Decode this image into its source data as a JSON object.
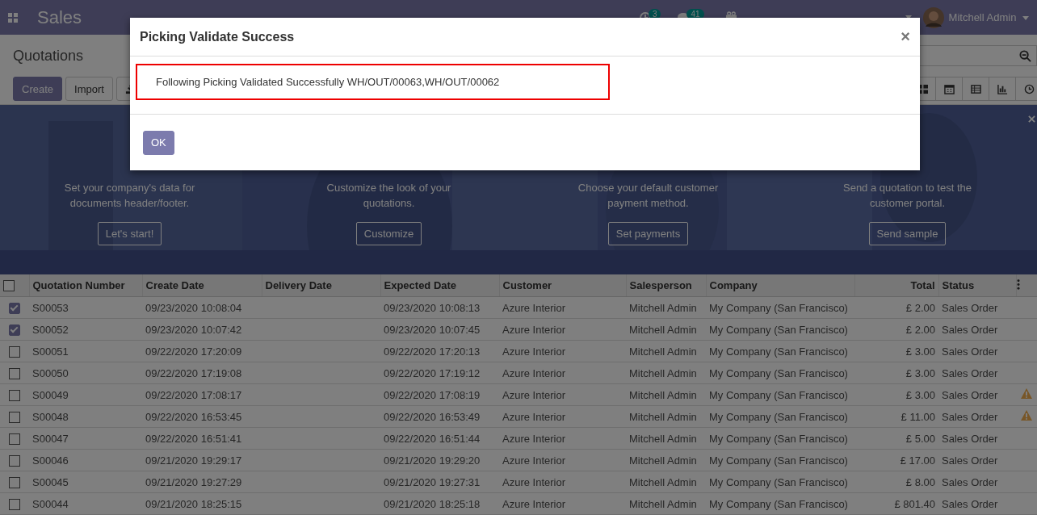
{
  "navbar": {
    "app_name": "Sales",
    "activity_count": "3",
    "message_count": "41",
    "user": "Mitchell Admin"
  },
  "control_panel": {
    "title": "Quotations",
    "buttons": [
      "Create",
      "Import"
    ]
  },
  "banner": {
    "cards": [
      {
        "text": "Set your company's data for documents header/footer.",
        "button": "Let's start!"
      },
      {
        "text": "Customize the look of your quotations.",
        "button": "Customize"
      },
      {
        "text": "Choose your default customer payment method.",
        "button": "Set payments"
      },
      {
        "text": "Send a quotation to test the customer portal.",
        "button": "Send sample"
      }
    ]
  },
  "table": {
    "all_selected": false,
    "columns": [
      {
        "label": "Quotation Number"
      },
      {
        "label": "Create Date"
      },
      {
        "label": "Delivery Date"
      },
      {
        "label": "Expected Date"
      },
      {
        "label": "Customer"
      },
      {
        "label": "Salesperson"
      },
      {
        "label": "Company"
      },
      {
        "label": "Total",
        "kind": "number"
      },
      {
        "label": "Status"
      }
    ],
    "rows": [
      {
        "selected": true,
        "number": "S00053",
        "create_date": "09/23/2020 10:08:04",
        "expected_date": "09/23/2020 10:08:13",
        "customer": "Azure Interior",
        "salesperson": "Mitchell Admin",
        "company": "My Company (San Francisco)",
        "total": "£ 2.00",
        "status": "Sales Order",
        "warning": false
      },
      {
        "selected": true,
        "number": "S00052",
        "create_date": "09/23/2020 10:07:42",
        "expected_date": "09/23/2020 10:07:45",
        "customer": "Azure Interior",
        "salesperson": "Mitchell Admin",
        "company": "My Company (San Francisco)",
        "total": "£ 2.00",
        "status": "Sales Order",
        "warning": false
      },
      {
        "selected": false,
        "number": "S00051",
        "create_date": "09/22/2020 17:20:09",
        "expected_date": "09/22/2020 17:20:13",
        "customer": "Azure Interior",
        "salesperson": "Mitchell Admin",
        "company": "My Company (San Francisco)",
        "total": "£ 3.00",
        "status": "Sales Order",
        "warning": false
      },
      {
        "selected": false,
        "number": "S00050",
        "create_date": "09/22/2020 17:19:08",
        "expected_date": "09/22/2020 17:19:12",
        "customer": "Azure Interior",
        "salesperson": "Mitchell Admin",
        "company": "My Company (San Francisco)",
        "total": "£ 3.00",
        "status": "Sales Order",
        "warning": false
      },
      {
        "selected": false,
        "number": "S00049",
        "create_date": "09/22/2020 17:08:17",
        "expected_date": "09/22/2020 17:08:19",
        "customer": "Azure Interior",
        "salesperson": "Mitchell Admin",
        "company": "My Company (San Francisco)",
        "total": "£ 3.00",
        "status": "Sales Order",
        "warning": true
      },
      {
        "selected": false,
        "number": "S00048",
        "create_date": "09/22/2020 16:53:45",
        "expected_date": "09/22/2020 16:53:49",
        "customer": "Azure Interior",
        "salesperson": "Mitchell Admin",
        "company": "My Company (San Francisco)",
        "total": "£ 11.00",
        "status": "Sales Order",
        "warning": true
      },
      {
        "selected": false,
        "number": "S00047",
        "create_date": "09/22/2020 16:51:41",
        "expected_date": "09/22/2020 16:51:44",
        "customer": "Azure Interior",
        "salesperson": "Mitchell Admin",
        "company": "My Company (San Francisco)",
        "total": "£ 5.00",
        "status": "Sales Order",
        "warning": false
      },
      {
        "selected": false,
        "number": "S00046",
        "create_date": "09/21/2020 19:29:17",
        "expected_date": "09/21/2020 19:29:20",
        "customer": "Azure Interior",
        "salesperson": "Mitchell Admin",
        "company": "My Company (San Francisco)",
        "total": "£ 17.00",
        "status": "Sales Order",
        "warning": false
      },
      {
        "selected": false,
        "number": "S00045",
        "create_date": "09/21/2020 19:27:29",
        "expected_date": "09/21/2020 19:27:31",
        "customer": "Azure Interior",
        "salesperson": "Mitchell Admin",
        "company": "My Company (San Francisco)",
        "total": "£ 8.00",
        "status": "Sales Order",
        "warning": false
      },
      {
        "selected": false,
        "number": "S00044",
        "create_date": "09/21/2020 18:25:15",
        "expected_date": "09/21/2020 18:25:18",
        "customer": "Azure Interior",
        "salesperson": "Mitchell Admin",
        "company": "My Company (San Francisco)",
        "total": "£ 801.40",
        "status": "Sales Order",
        "warning": false
      }
    ]
  },
  "dialog": {
    "title": "Picking Validate Success",
    "close": "×",
    "message": "Following Picking Validated Successfully WH/OUT/00063,WH/OUT/00062",
    "button": "OK"
  }
}
